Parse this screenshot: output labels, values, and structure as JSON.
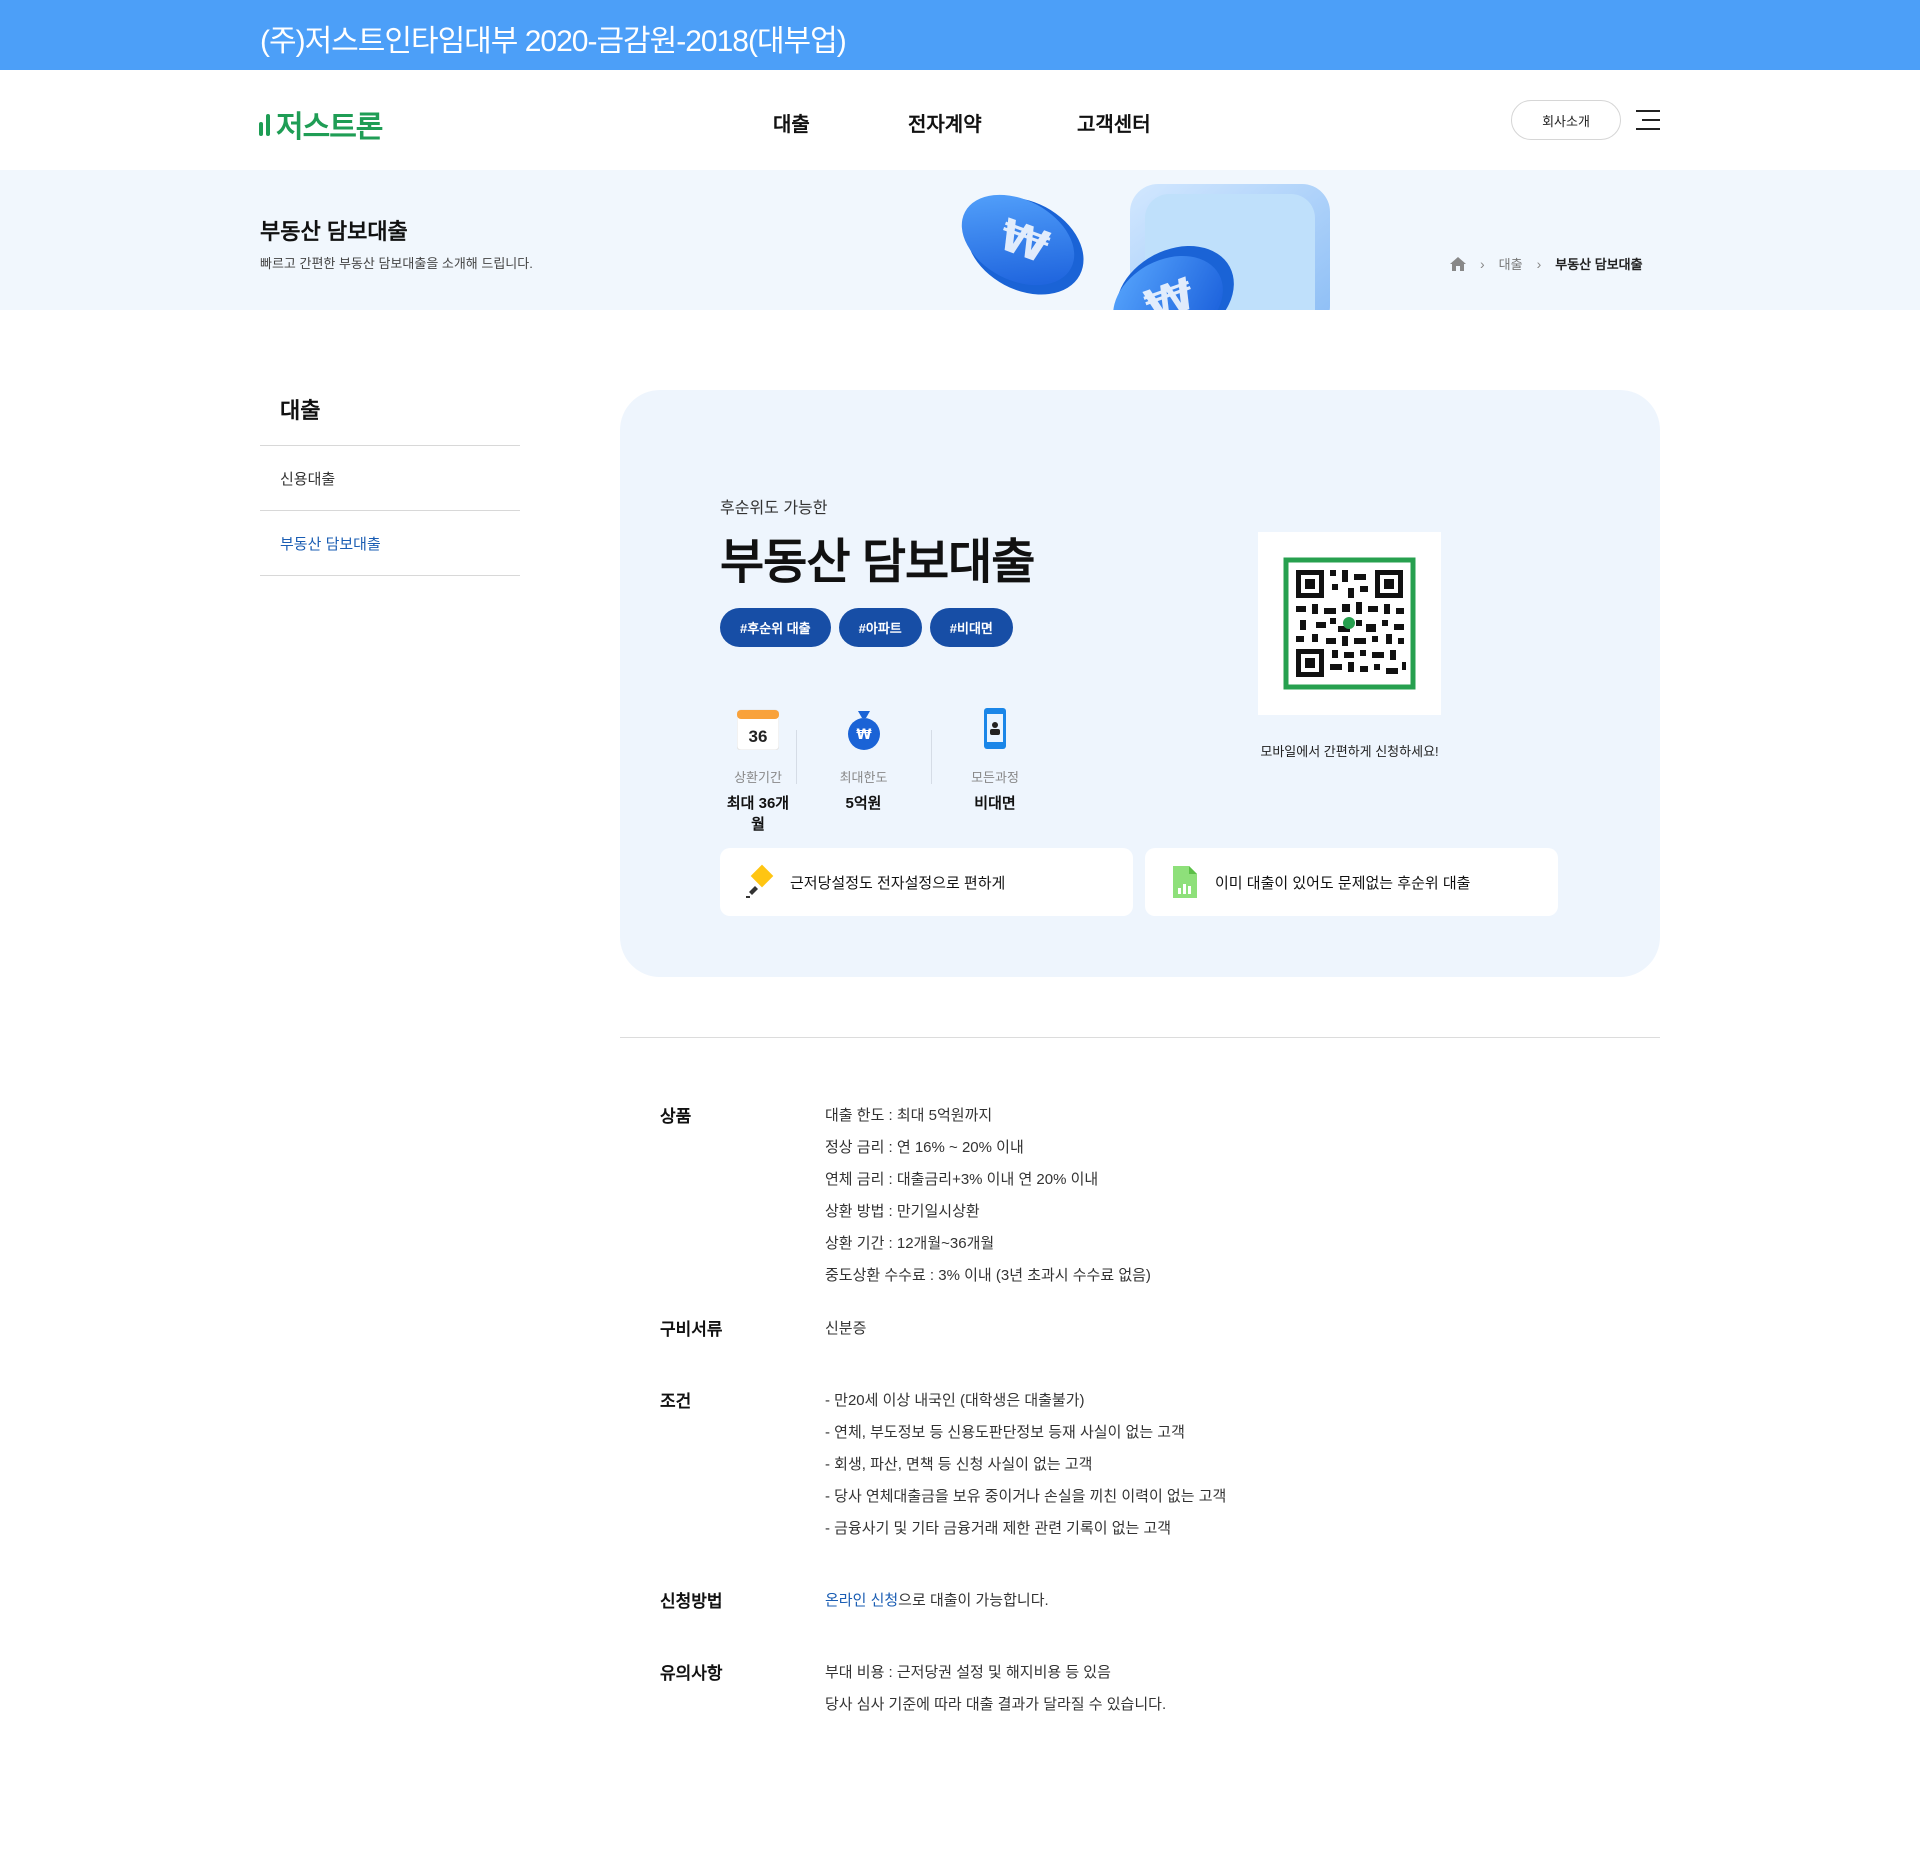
{
  "topbar": {
    "text": "(주)저스트인타임대부 2020-금감원-2018(대부업)",
    "bg": "#4c9ff8"
  },
  "header": {
    "logo": "저스트론",
    "nav": [
      "대출",
      "전자계약",
      "고객센터"
    ],
    "about_label": "회사소개",
    "menu_icon": "hamburger-menu-icon"
  },
  "hero": {
    "title": "부동산 담보대출",
    "subtitle": "빠르고 간편한 부동산 담보대출을 소개해 드립니다.",
    "breadcrumb": [
      "대출",
      "부동산 담보대출"
    ]
  },
  "sidebar": {
    "title": "대출",
    "items": [
      {
        "label": "신용대출",
        "active": false
      },
      {
        "label": "부동산 담보대출",
        "active": true
      }
    ]
  },
  "card": {
    "pre_title": "후순위도 가능한",
    "title": "부동산 담보대출",
    "tags": [
      "#후순위 대출",
      "#아파트",
      "#비대면"
    ],
    "stats": [
      {
        "icon": "calendar-icon",
        "icon_text": "36",
        "label": "상환기간",
        "value": "최대 36개월"
      },
      {
        "icon": "money-bag-icon",
        "icon_text": "₩",
        "label": "최대한도",
        "value": "5억원"
      },
      {
        "icon": "mobile-phone-icon",
        "label": "모든과정",
        "value": "비대면"
      }
    ],
    "qr_caption": "모바일에서 간편하게 신청하세요!",
    "features": [
      {
        "icon": "pencil-icon",
        "text": "근저당설정도 전자설정으로 편하게"
      },
      {
        "icon": "document-chart-icon",
        "text": "이미 대출이 있어도 문제없는 후순위 대출"
      }
    ]
  },
  "info": [
    {
      "label": "상품",
      "lines": [
        "대출 한도 : 최대 5억원까지",
        "정상 금리 : 연 16% ~ 20% 이내",
        "연체 금리 : 대출금리+3% 이내 연 20% 이내",
        "상환 방법 : 만기일시상환",
        "상환 기간 : 12개월~36개월",
        "중도상환 수수료 : 3% 이내 (3년 초과시 수수료 없음)"
      ]
    },
    {
      "label": "구비서류",
      "lines": [
        "신분증"
      ]
    },
    {
      "label": "조건",
      "lines": [
        "- 만20세 이상 내국인 (대학생은 대출불가)",
        "- 연체, 부도정보 등 신용도판단정보 등재 사실이 없는 고객",
        "- 회생, 파산, 면책 등 신청 사실이 없는 고객",
        "- 당사 연체대출금을 보유 중이거나 손실을 끼친 이력이 없는 고객",
        "- 금융사기 및 기타 금융거래 제한 관련 기록이 없는 고객"
      ]
    },
    {
      "label": "신청방법",
      "link": "온라인 신청",
      "after_link": "으로 대출이 가능합니다."
    },
    {
      "label": "유의사항",
      "lines": [
        "부대 비용 : 근저당권 설정 및 해지비용 등 있음",
        "당사 심사 기준에 따라 대출 결과가 달라질 수 있습니다."
      ]
    }
  ],
  "colors": {
    "accent_blue": "#174ea6",
    "logo_green": "#1f9d55",
    "link_blue": "#1a5db3"
  }
}
